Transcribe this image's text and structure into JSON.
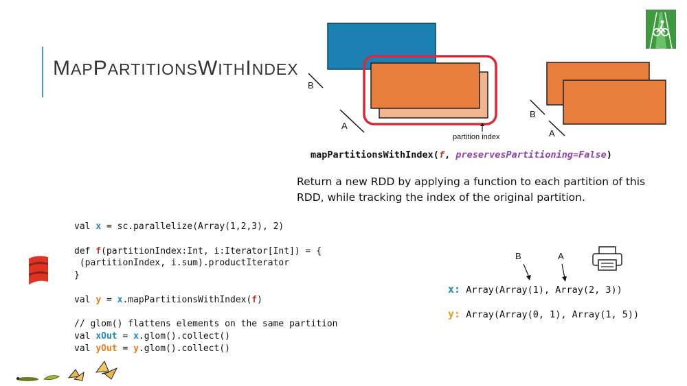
{
  "title": {
    "part1": "M",
    "part2": "AP",
    "part3": "P",
    "part4": "ARTITIONS",
    "part5": "W",
    "part6": "ITH",
    "part7": "I",
    "part8": "NDEX"
  },
  "diagram": {
    "label_b_left": "B",
    "label_a_left": "A",
    "label_b_right": "B",
    "label_a_right": "A",
    "partition_index_label": "partition index",
    "colors": {
      "blue": "#1a81b2",
      "orange": "#e77e3e",
      "light_orange": "#f3b58f",
      "highlight": "#d62a37"
    }
  },
  "signature": {
    "name": "mapPartitionsWithIndex(",
    "f": "f",
    "comma": ", ",
    "param": "preservesPartitioning=False",
    "close": ")"
  },
  "description": "Return a new RDD by applying a function to each partition of this RDD, while tracking the index of the original partition.",
  "code": {
    "l1_a": "val ",
    "l1_x": "x",
    "l1_b": " = sc.parallelize(Array(1,2,3), 2)",
    "l2_a": "def ",
    "l2_f": "f",
    "l2_b": "(partitionIndex:Int, i:Iterator[Int]) = {",
    "l3": " (partitionIndex, i.sum).productIterator",
    "l4": "}",
    "l5_a": "val ",
    "l5_y": "y",
    "l5_b": " = ",
    "l5_x": "x",
    "l5_c": ".mapPartitionsWithIndex(",
    "l5_f": "f",
    "l5_d": ")",
    "l6": "// glom() flattens elements on the same partition",
    "l7_a": "val ",
    "l7_xo": "xOut",
    "l7_b": " = ",
    "l7_x": "x",
    "l7_c": ".glom().collect()",
    "l8_a": "val ",
    "l8_yo": "yOut",
    "l8_b": " = ",
    "l8_y": "y",
    "l8_c": ".glom().collect()"
  },
  "output": {
    "label_b": "B",
    "label_a": "A",
    "x_label": "x:",
    "x_value": "Array(Array(1), Array(2, 3))",
    "y_label": "y:",
    "y_value": "Array(Array(0, 1), Array(1, 5))"
  },
  "icons": [
    "bike-lane-icon",
    "printer-icon",
    "scala-logo-icon",
    "caterpillar-butterfly-icon"
  ]
}
